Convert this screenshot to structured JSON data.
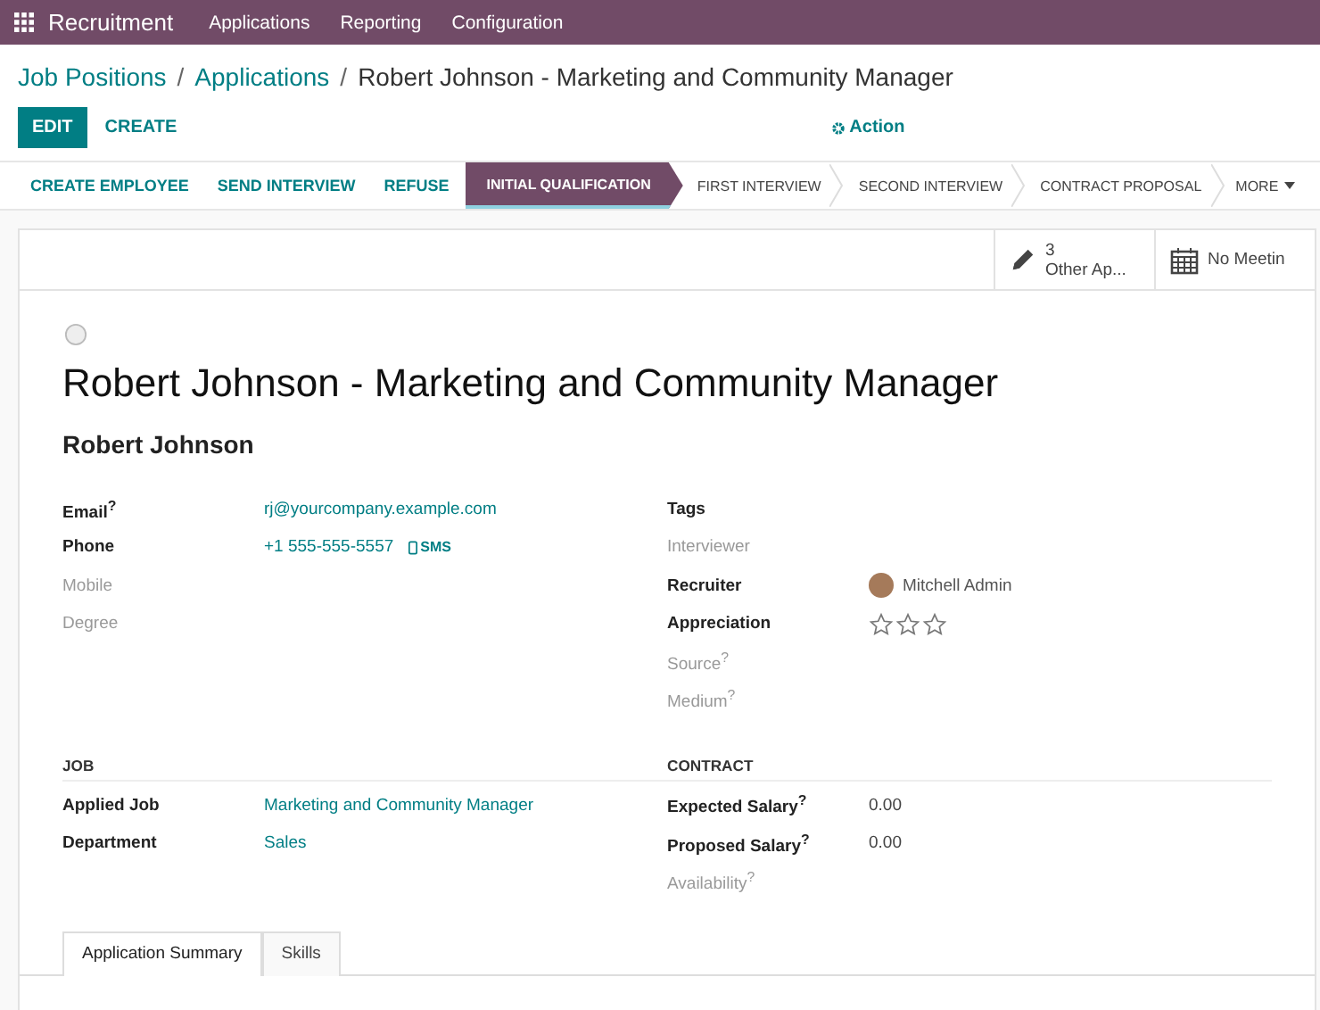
{
  "navbar": {
    "app": "Recruitment",
    "menu": [
      "Applications",
      "Reporting",
      "Configuration"
    ]
  },
  "breadcrumb_separator": "/",
  "breadcrumb": [
    {
      "label": "Job Positions",
      "link": true
    },
    {
      "label": "Applications",
      "link": true
    },
    {
      "label": "Robert Johnson - Marketing and Community Manager",
      "link": false
    }
  ],
  "buttons": {
    "edit": "EDIT",
    "create": "CREATE",
    "action": "Action"
  },
  "actions": [
    "CREATE EMPLOYEE",
    "SEND INTERVIEW",
    "REFUSE"
  ],
  "stages": [
    {
      "label": "INITIAL QUALIFICATION",
      "selected": true
    },
    {
      "label": "FIRST INTERVIEW",
      "selected": false
    },
    {
      "label": "SECOND INTERVIEW",
      "selected": false
    },
    {
      "label": "CONTRACT PROPOSAL",
      "selected": false
    }
  ],
  "more": "MORE",
  "smart_buttons": [
    {
      "kind": "applications",
      "count": "3",
      "label": "Other Ap..."
    },
    {
      "kind": "meetings",
      "label": "No Meetin"
    }
  ],
  "title": "Robert Johnson - Marketing and Community Manager",
  "partner": "Robert Johnson",
  "left_fields": [
    {
      "label": "Email$^{?}$",
      "muted": false,
      "kind": "link",
      "value": "rj@yourcompany.example.com"
    },
    {
      "label": "Phone",
      "muted": false,
      "kind": "link",
      "value": "+1 555-555-5557",
      "sms": "SMS"
    },
    {
      "label": "Mobile",
      "muted": true,
      "kind": "empty"
    },
    {
      "label": "Degree",
      "muted": true,
      "kind": "empty"
    }
  ],
  "right_fields": [
    {
      "label": "Tags",
      "muted": false,
      "kind": "empty"
    },
    {
      "label": "Interviewer",
      "muted": true,
      "kind": "empty"
    },
    {
      "label": "Recruiter",
      "muted": false,
      "kind": "user",
      "value": "Mitchell Admin"
    },
    {
      "label": "Appreciation",
      "muted": false,
      "kind": "stars",
      "stars": 0
    },
    {
      "label": "Source$^{?}$",
      "muted": true,
      "kind": "empty"
    },
    {
      "label": "Medium$^{?}$",
      "muted": true,
      "kind": "empty"
    }
  ],
  "job": {
    "heading": "JOB",
    "fields": [
      {
        "label": "Applied Job",
        "muted": false,
        "kind": "link",
        "value": "Marketing and Community Manager"
      },
      {
        "label": "Department",
        "muted": false,
        "kind": "link",
        "value": "Sales"
      }
    ]
  },
  "contract": {
    "heading": "CONTRACT",
    "fields": [
      {
        "label": "Expected Salary$^{?}$",
        "muted": false,
        "kind": "text",
        "value": "0.00"
      },
      {
        "label": "Proposed Salary$^{?}$",
        "muted": false,
        "kind": "text",
        "value": "0.00"
      },
      {
        "label": "Availability$^{?}$",
        "muted": true,
        "kind": "empty"
      }
    ]
  },
  "tabs": [
    {
      "label": "Application Summary",
      "selected": true
    },
    {
      "label": "Skills",
      "selected": false
    }
  ]
}
